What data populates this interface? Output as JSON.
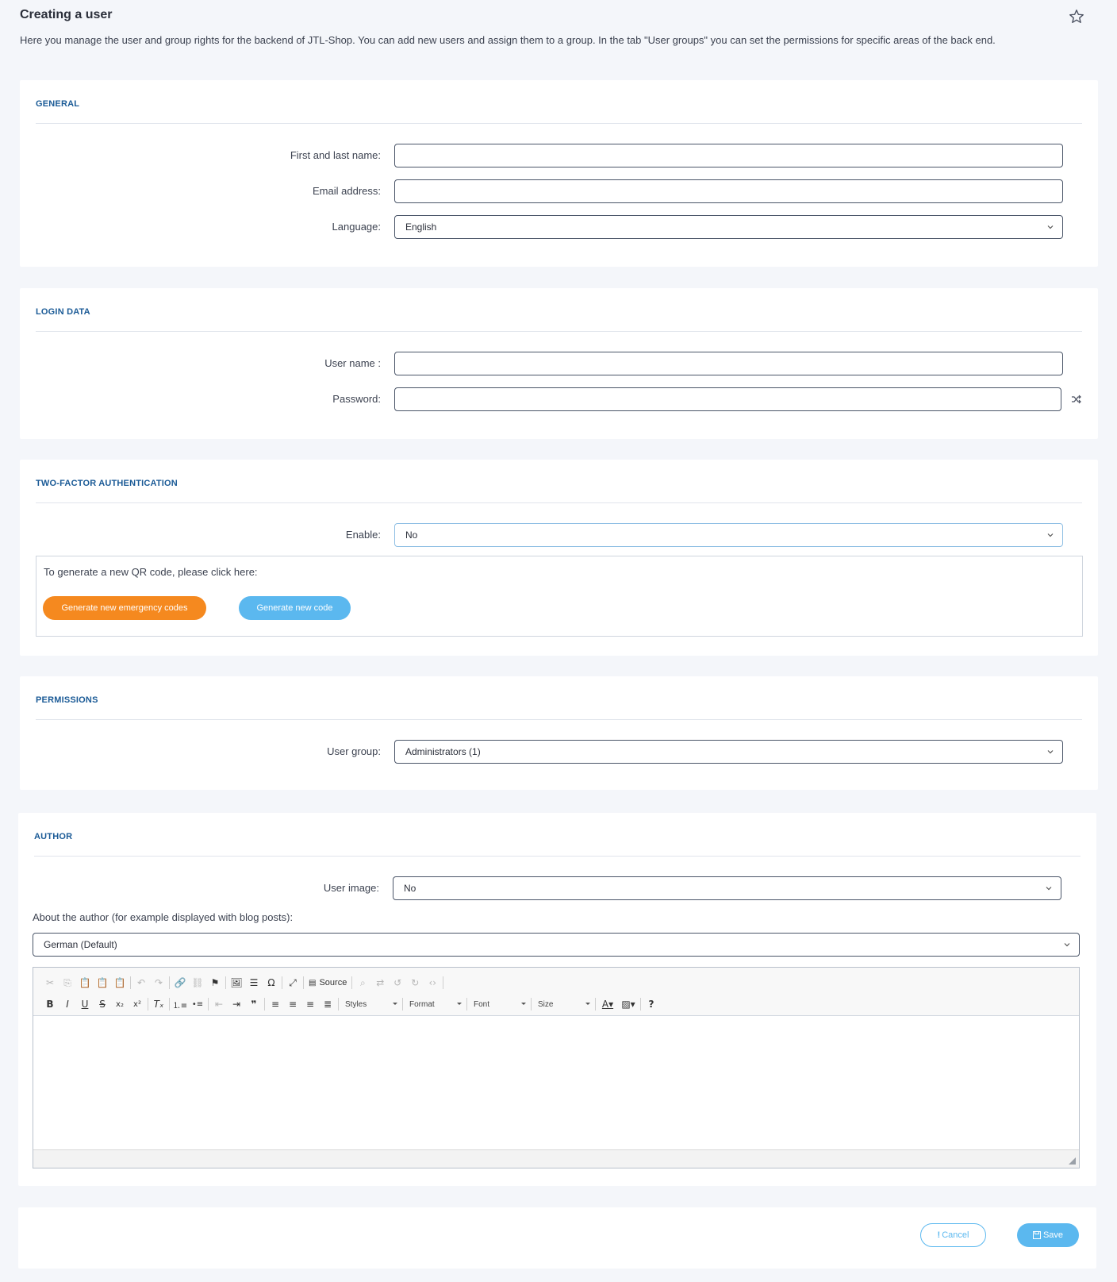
{
  "page": {
    "title": "Creating a user",
    "intro": "Here you manage the user and group rights for the backend of JTL-Shop. You can add new users and assign them to a group. In the tab \"User groups\" you can set the permissions for specific areas of the back end."
  },
  "general": {
    "title": "GENERAL",
    "name_label": "First and last name:",
    "name_value": "",
    "email_label": "Email address:",
    "email_value": "",
    "language_label": "Language:",
    "language_value": "English"
  },
  "login": {
    "title": "LOGIN DATA",
    "username_label": "User name :",
    "username_value": "",
    "password_label": "Password:",
    "password_value": ""
  },
  "twofa": {
    "title": "TWO-FACTOR AUTHENTICATION",
    "enable_label": "Enable:",
    "enable_value": "No",
    "qr_text": "To generate a new QR code, please click here:",
    "emergency_button": "Generate new emergency codes",
    "new_code_button": "Generate new code"
  },
  "permissions": {
    "title": "PERMISSIONS",
    "group_label": "User group:",
    "group_value": "Administrators (1)"
  },
  "author": {
    "title": "AUTHOR",
    "image_label": "User image:",
    "image_value": "No",
    "about_label": "About the author (for example displayed with blog posts):",
    "language_value": "German (Default)",
    "toolbar": {
      "source_label": "Source",
      "styles_label": "Styles",
      "format_label": "Format",
      "font_label": "Font",
      "size_label": "Size"
    }
  },
  "footer": {
    "cancel_label": "Cancel",
    "save_label": "Save"
  },
  "colors": {
    "accent": "#5bb8ef",
    "orange": "#f5891f",
    "section_title": "#1a5a96"
  }
}
